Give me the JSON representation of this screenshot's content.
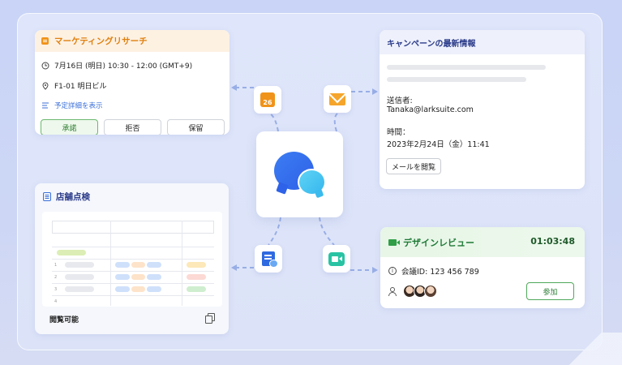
{
  "marketing": {
    "title": "マーケティングリサーチ",
    "datetime": "7月16日 (明日) 10:30 - 12:00 (GMT+9)",
    "location": "F1-01 明日ビル",
    "details_link": "予定詳細を表示",
    "accept": "承諾",
    "decline": "拒否",
    "hold": "保留"
  },
  "campaign": {
    "title": "キャンペーンの最新情報",
    "sender_label": "送信者:",
    "sender": "Tanaka@larksuite.com",
    "time_label": "時間：",
    "time": "2023年2月24日（金）11:41",
    "view_mail": "メールを閲覧"
  },
  "store": {
    "title": "店舗点検",
    "footer": "閲覧可能",
    "row_numbers": [
      "1",
      "2",
      "3",
      "4"
    ]
  },
  "review": {
    "title": "デザインレビュー",
    "timer": "01:03:48",
    "meeting_id": "会議ID: 123 456 789",
    "join": "参加"
  },
  "calendar_app": {
    "day": "26"
  },
  "colors": {
    "calendar_orange": "#f0931a",
    "link_blue": "#3b6fd8",
    "accept_green": "#6cb86f",
    "review_green": "#1f7a36",
    "title_navy": "#2b3b8a",
    "chat_blue": "#2e60e8",
    "chat_cyan": "#36b7ee"
  },
  "icons": {
    "center": "chat-bubbles-icon",
    "apps": [
      "calendar-icon",
      "mail-icon",
      "docs-icon",
      "video-meeting-icon"
    ]
  }
}
